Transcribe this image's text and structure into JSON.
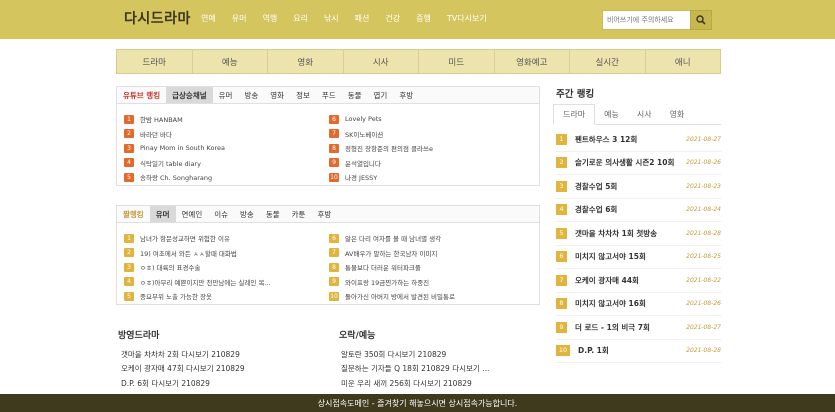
{
  "header": {
    "logo": "다시드라마",
    "nav": [
      "연예",
      "유머",
      "역행",
      "요리",
      "낚시",
      "패션",
      "건강",
      "증행",
      "TV다시보기"
    ],
    "search_placeholder": "비어쓰기에 주의하세요"
  },
  "categories": [
    "드라마",
    "예능",
    "영화",
    "시사",
    "미드",
    "영화예고",
    "실시간",
    "애니"
  ],
  "youtube": {
    "tabs": [
      "유튜브 랭킹",
      "급상승채널",
      "유머",
      "방송",
      "영화",
      "정보",
      "푸드",
      "동물",
      "엽기",
      "후방"
    ],
    "left": [
      {
        "n": "1",
        "t": "한밤 HANBAM"
      },
      {
        "n": "2",
        "t": "바라던 바다"
      },
      {
        "n": "3",
        "t": "Pinay Mom in South Korea"
      },
      {
        "n": "4",
        "t": "식탁일기 table diary"
      },
      {
        "n": "5",
        "t": "송하랑 Ch. Songharang"
      }
    ],
    "right": [
      {
        "n": "6",
        "t": "Lovely Pets"
      },
      {
        "n": "7",
        "t": "SK이노베이션"
      },
      {
        "n": "8",
        "t": "정형진 장항준의 편의점 클라쓰e"
      },
      {
        "n": "9",
        "t": "윤석열입니다"
      },
      {
        "n": "10",
        "t": "나경 JESSY"
      }
    ]
  },
  "community": {
    "tabs": [
      "짤랭킹",
      "유머",
      "연예인",
      "이슈",
      "방송",
      "동물",
      "카툰",
      "후방"
    ],
    "left": [
      {
        "n": "1",
        "t": "남녀가 항문성교하면 위험한 이유"
      },
      {
        "n": "2",
        "t": "19) 여초에서 와든 ㅅㅅ할때 대화법"
      },
      {
        "n": "3",
        "t": "ㅇㅎ) 대륙의 표경수술"
      },
      {
        "n": "4",
        "t": "ㅇㅎ)아무리 예쁜이지만 천만남에는 실례인 복..."
      },
      {
        "n": "5",
        "t": "중요부위 노출 가능한 장옷"
      }
    ],
    "right": [
      {
        "n": "6",
        "t": "앓은 다리 여자를 볼 때 남녀별 생각"
      },
      {
        "n": "7",
        "t": "AV배우가 말하는 한국남자 이미지"
      },
      {
        "n": "8",
        "t": "통물보다 더러운 워터파크풀"
      },
      {
        "n": "9",
        "t": "와이프랑 19금찐가하는 하중진"
      },
      {
        "n": "10",
        "t": "돌아가신 아버지 방에서 발견된 비밀통로"
      }
    ]
  },
  "drama_section": {
    "title": "방영드라마",
    "items": [
      "갯마을 차차차 2회 다시보기 210829",
      "오케이 광자매 47회 다시보기 210829",
      "D.P. 6회 다시보기 210829"
    ]
  },
  "variety_section": {
    "title": "오락/예능",
    "items": [
      "알토란 350회 다시보기 210829",
      "질문하는 기자들 Q 18회 210829 다시보기 ...",
      "미운 우리 새끼 256회 다시보기 210829"
    ]
  },
  "ranking": {
    "title": "주간 랭킹",
    "tabs": [
      "드라마",
      "예능",
      "시사",
      "영화"
    ],
    "items": [
      {
        "n": "1",
        "t": "펜트하우스 3 12회",
        "d": "2021-08-27"
      },
      {
        "n": "2",
        "t": "슬기로운 의사생활 시즌2 10회",
        "d": "2021-08-26"
      },
      {
        "n": "3",
        "t": "경찰수업 5회",
        "d": "2021-08-23"
      },
      {
        "n": "4",
        "t": "경찰수업 6회",
        "d": "2021-08-24"
      },
      {
        "n": "5",
        "t": "갯마을 차차차 1회 첫방송",
        "d": "2021-08-28"
      },
      {
        "n": "6",
        "t": "미치지 않고서야 15회",
        "d": "2021-08-25"
      },
      {
        "n": "7",
        "t": "오케이 광자매 44회",
        "d": "2021-08-22"
      },
      {
        "n": "8",
        "t": "미치지 않고서야 16회",
        "d": "2021-08-26"
      },
      {
        "n": "9",
        "t": "더 로드 - 1의 비극 7회",
        "d": "2021-08-27"
      },
      {
        "n": "10",
        "t": "D.P. 1회",
        "d": "2021-08-28"
      }
    ]
  },
  "footer": {
    "text": "상시접속도메인 - 즐겨찾기 해놓으시면 상시접속가능합니다."
  }
}
